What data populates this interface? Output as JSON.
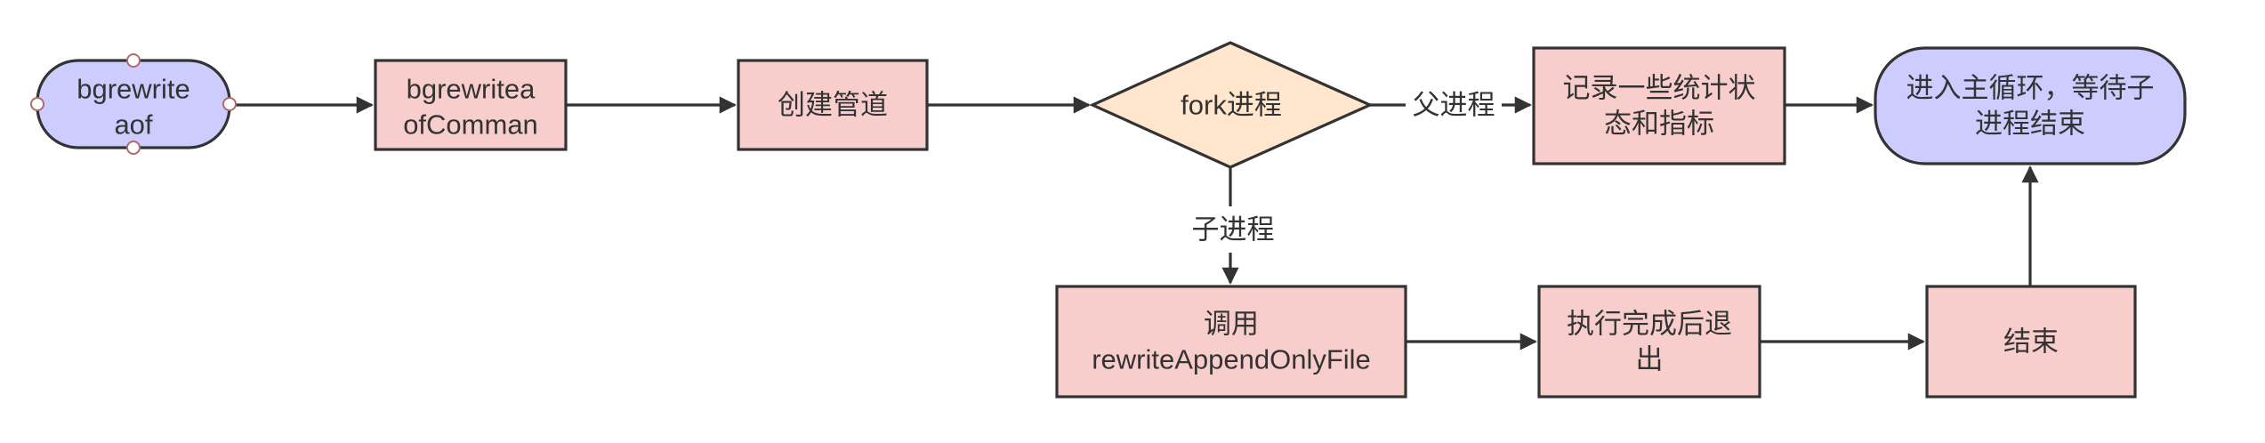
{
  "nodes": {
    "start": {
      "lines": [
        "bgrewrite",
        "aof"
      ]
    },
    "bgrewriteaofCommand": {
      "lines": [
        "bgrewritea",
        "ofComman"
      ]
    },
    "createPipe": {
      "lines": [
        "创建管道"
      ]
    },
    "fork": {
      "lines": [
        "fork进程"
      ]
    },
    "recordStats": {
      "lines": [
        "记录一些统计状",
        "态和指标"
      ]
    },
    "mainLoop": {
      "lines": [
        "进入主循环，等待子",
        "进程结束"
      ]
    },
    "callRewrite": {
      "lines": [
        "调用",
        "rewriteAppendOnlyFile"
      ]
    },
    "execExit": {
      "lines": [
        "执行完成后退",
        "出"
      ]
    },
    "end": {
      "lines": [
        "结束"
      ]
    }
  },
  "edge_labels": {
    "parent": "父进程",
    "child": "子进程"
  },
  "colors": {
    "terminal_fill": "#ccccff",
    "process_fill": "#f8cecc",
    "decision_fill": "#ffe6cc",
    "stroke": "#333333"
  }
}
